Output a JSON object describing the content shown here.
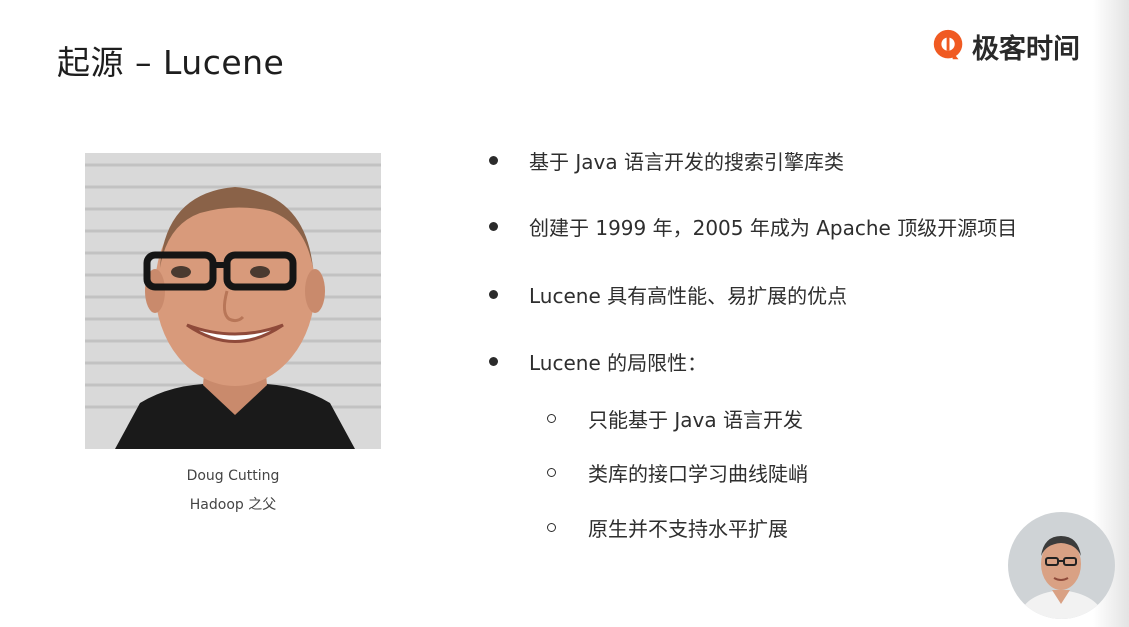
{
  "slide": {
    "title": "起源 – Lucene"
  },
  "logo": {
    "text": "极客时间",
    "icon": "geektime-logo-icon",
    "accent": "#f05a22"
  },
  "portrait": {
    "name": "Doug Cutting",
    "role": "Hadoop 之父"
  },
  "bullets": [
    {
      "text": "基于 Java 语言开发的搜索引擎库类"
    },
    {
      "text": "创建于 1999 年，2005 年成为 Apache 顶级开源项目"
    },
    {
      "text": "Lucene 具有高性能、易扩展的优点"
    },
    {
      "text": "Lucene 的局限性："
    }
  ],
  "sub_bullets": [
    {
      "text": "只能基于 Java 语言开发"
    },
    {
      "text": "类库的接口学习曲线陡峭"
    },
    {
      "text": "原生并不支持水平扩展"
    }
  ]
}
